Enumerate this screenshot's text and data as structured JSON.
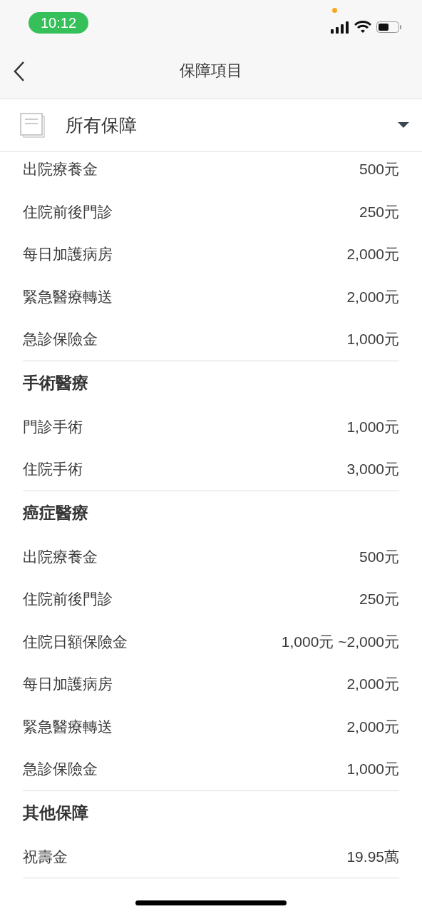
{
  "status_bar": {
    "time": "10:12"
  },
  "nav": {
    "title": "保障項目"
  },
  "filter": {
    "label": "所有保障"
  },
  "sections": [
    {
      "items": [
        {
          "name": "出院療養金",
          "amount": "500元"
        },
        {
          "name": "住院前後門診",
          "amount": "250元"
        },
        {
          "name": "每日加護病房",
          "amount": "2,000元"
        },
        {
          "name": "緊急醫療轉送",
          "amount": "2,000元"
        },
        {
          "name": "急診保險金",
          "amount": "1,000元"
        }
      ]
    },
    {
      "title": "手術醫療",
      "items": [
        {
          "name": "門診手術",
          "amount": "1,000元"
        },
        {
          "name": "住院手術",
          "amount": "3,000元"
        }
      ]
    },
    {
      "title": "癌症醫療",
      "items": [
        {
          "name": "出院療養金",
          "amount": "500元"
        },
        {
          "name": "住院前後門診",
          "amount": "250元"
        },
        {
          "name": "住院日額保險金",
          "amount": "1,000元 ~2,000元"
        },
        {
          "name": "每日加護病房",
          "amount": "2,000元"
        },
        {
          "name": "緊急醫療轉送",
          "amount": "2,000元"
        },
        {
          "name": "急診保險金",
          "amount": "1,000元"
        }
      ]
    },
    {
      "title": "其他保障",
      "items": [
        {
          "name": "祝壽金",
          "amount": "19.95萬"
        }
      ]
    }
  ]
}
